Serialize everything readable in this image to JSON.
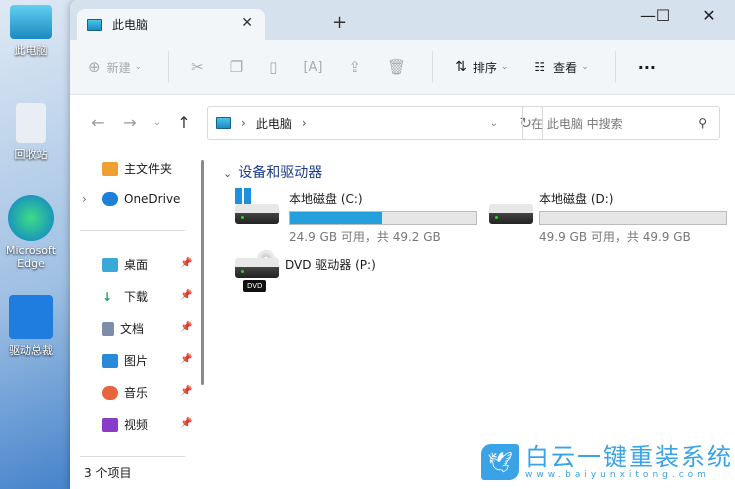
{
  "desktop": {
    "icons": [
      "此电脑",
      "回收站",
      "Microsoft Edge",
      "驱动总裁"
    ]
  },
  "window": {
    "tab_title": "此电脑",
    "new_tab": "+",
    "minimize": "—",
    "maximize": "☐",
    "close": "✕"
  },
  "toolbar": {
    "new": "新建",
    "sort": "排序",
    "view": "查看",
    "more": "···"
  },
  "address": {
    "path": "此电脑",
    "search_placeholder": "在 此电脑 中搜索"
  },
  "sidebar": {
    "items": [
      {
        "label": "主文件夹"
      },
      {
        "label": "OneDrive"
      },
      {
        "label": "桌面"
      },
      {
        "label": "下载"
      },
      {
        "label": "文档"
      },
      {
        "label": "图片"
      },
      {
        "label": "音乐"
      },
      {
        "label": "视频"
      }
    ]
  },
  "main": {
    "group": "设备和驱动器",
    "drives": [
      {
        "name": "本地磁盘 (C:)",
        "free": "24.9 GB 可用，共 49.2 GB",
        "used_fraction": 0.494
      },
      {
        "name": "本地磁盘 (D:)",
        "free": "49.9 GB 可用，共 49.9 GB",
        "used_fraction": 0.0
      },
      {
        "name": "DVD 驱动器 (P:)",
        "badge": "DVD"
      }
    ]
  },
  "status": {
    "count": "3 个项目"
  },
  "watermark": {
    "title": "白云一键重装系统",
    "url": "www.baiyunxitong.com"
  },
  "colors": {
    "accent": "#26a0da",
    "titlebar": "#d5e2ed"
  }
}
